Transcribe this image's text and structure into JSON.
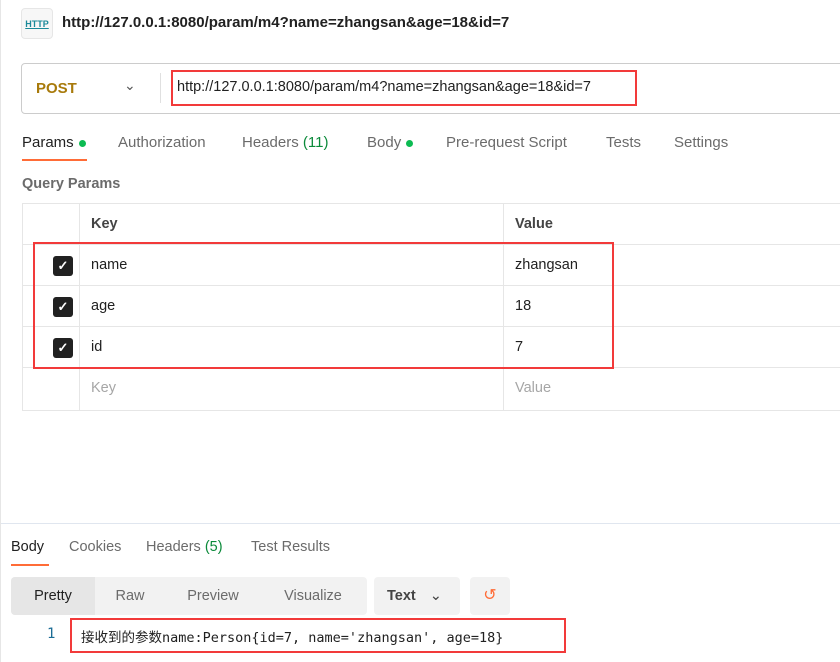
{
  "header": {
    "icon": "http-icon",
    "icon_label": "HTTP",
    "title": "http://127.0.0.1:8080/param/m4?name=zhangsan&age=18&id=7"
  },
  "request": {
    "method": "POST",
    "url": "http://127.0.0.1:8080/param/m4?name=zhangsan&age=18&id=7"
  },
  "tabs": {
    "params": "Params",
    "authorization": "Authorization",
    "headers": "Headers",
    "headers_count": "(11)",
    "body": "Body",
    "prerequest": "Pre-request Script",
    "tests": "Tests",
    "settings": "Settings"
  },
  "query_params": {
    "title": "Query Params",
    "col_key": "Key",
    "col_value": "Value",
    "rows": [
      {
        "key": "name",
        "value": "zhangsan",
        "checked": true
      },
      {
        "key": "age",
        "value": "18",
        "checked": true
      },
      {
        "key": "id",
        "value": "7",
        "checked": true
      }
    ],
    "placeholder_key": "Key",
    "placeholder_value": "Value"
  },
  "response": {
    "tabs": {
      "body": "Body",
      "cookies": "Cookies",
      "headers": "Headers",
      "headers_count": "(5)",
      "test_results": "Test Results"
    },
    "views": [
      "Pretty",
      "Raw",
      "Preview",
      "Visualize"
    ],
    "format": "Text",
    "lines": [
      {
        "num": "1",
        "text": "接收到的参数name:Person{id=7, name='zhangsan', age=18}"
      }
    ]
  },
  "colors": {
    "accent": "#ff6c37",
    "highlight": "#f23a3a",
    "method": "#a87a0b"
  }
}
